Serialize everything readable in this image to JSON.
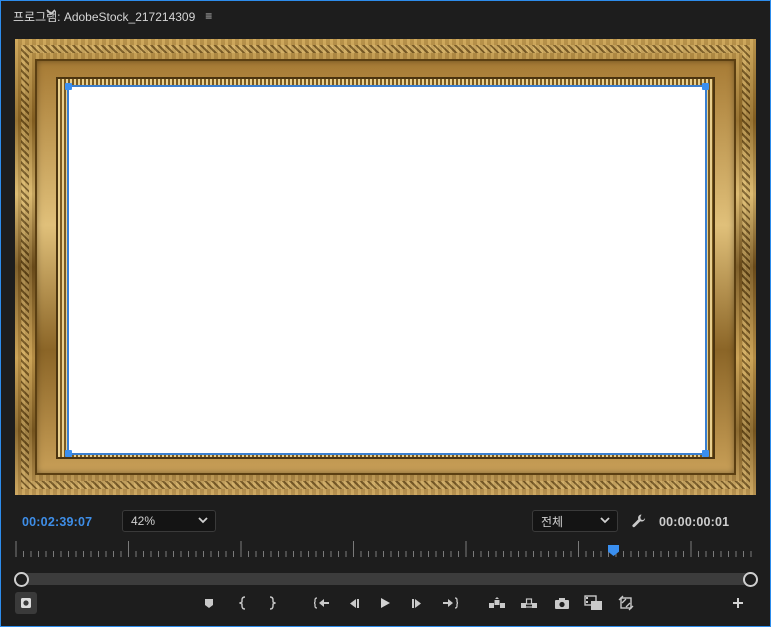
{
  "panel": {
    "title": "프로그램: AdobeStock_217214309",
    "menu_icon": "hamburger-icon"
  },
  "viewer": {
    "content": "ornate gold picture frame with white canvas"
  },
  "timecode": {
    "current": "00:02:39:07",
    "duration": "00:00:00:01"
  },
  "zoom": {
    "selected": "42%"
  },
  "resolution": {
    "selected": "전체"
  },
  "colors": {
    "accent": "#3e8ee8",
    "panel_bg": "#1d1d1d",
    "border": "#2d8ceb"
  },
  "transport_buttons": [
    "add-marker-icon",
    "mark-in-icon",
    "mark-out-icon",
    "go-to-in-icon",
    "step-back-icon",
    "play-icon",
    "step-forward-icon",
    "go-to-out-icon",
    "lift-icon",
    "extract-icon",
    "export-frame-icon",
    "comparison-view-icon",
    "toggle-proxies-icon",
    "add-button-icon"
  ]
}
